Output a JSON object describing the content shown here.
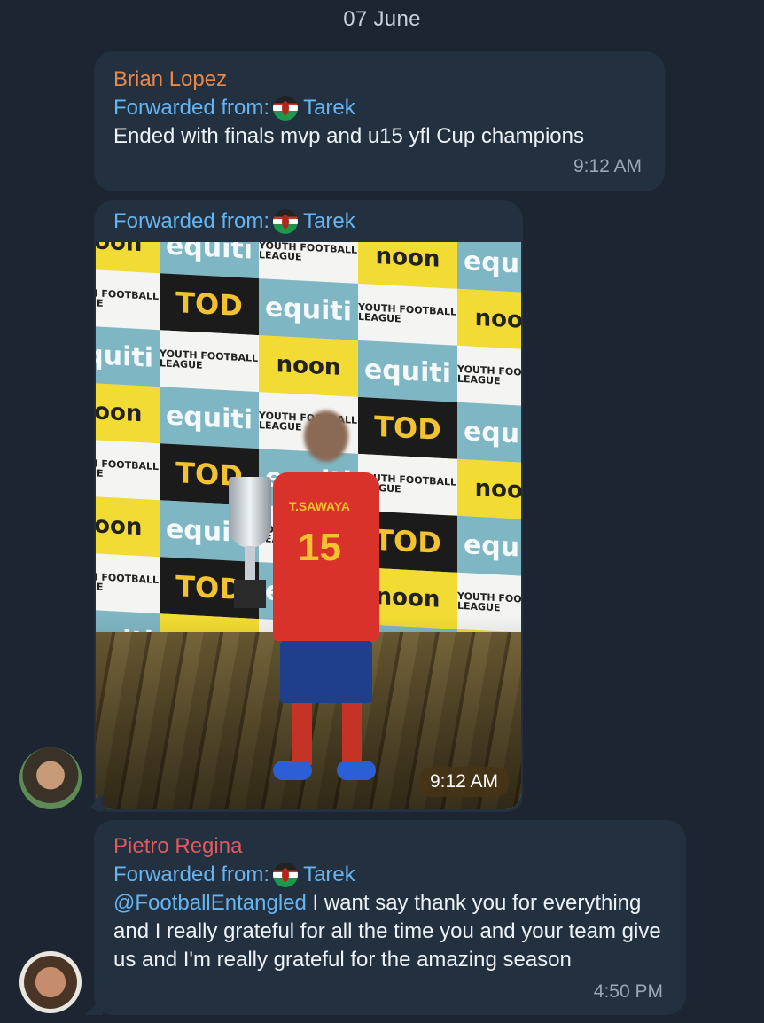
{
  "date_separator": "07 June",
  "messages": [
    {
      "sender": "Brian Lopez",
      "forwarded_label": "Forwarded from:",
      "forwarded_name": "Tarek",
      "text": "Ended with finals mvp and u15 yfl Cup champions",
      "time": "9:12 AM"
    },
    {
      "forwarded_label": "Forwarded from:",
      "forwarded_name": "Tarek",
      "photo_time": "9:12 AM",
      "photo": {
        "backdrop_tiles": [
          "equiti",
          "noon",
          "TOD",
          "YOUTH FOOTBALL LEAGUE"
        ],
        "jersey_name": "T.SAWAYA",
        "jersey_number": "15"
      }
    },
    {
      "sender": "Pietro Regina",
      "forwarded_label": "Forwarded from:",
      "forwarded_name": "Tarek",
      "mention": "@FootballEntangled",
      "text": " I want say thank you for everything and I really grateful for all the time you and your team give us and I'm really grateful for the amazing season",
      "time": "4:50 PM"
    }
  ],
  "colors": {
    "background": "#1c2531",
    "bubble": "#223040",
    "link": "#67b5f0",
    "sender_brian": "#e8894a",
    "sender_pietro": "#e15a5f"
  }
}
